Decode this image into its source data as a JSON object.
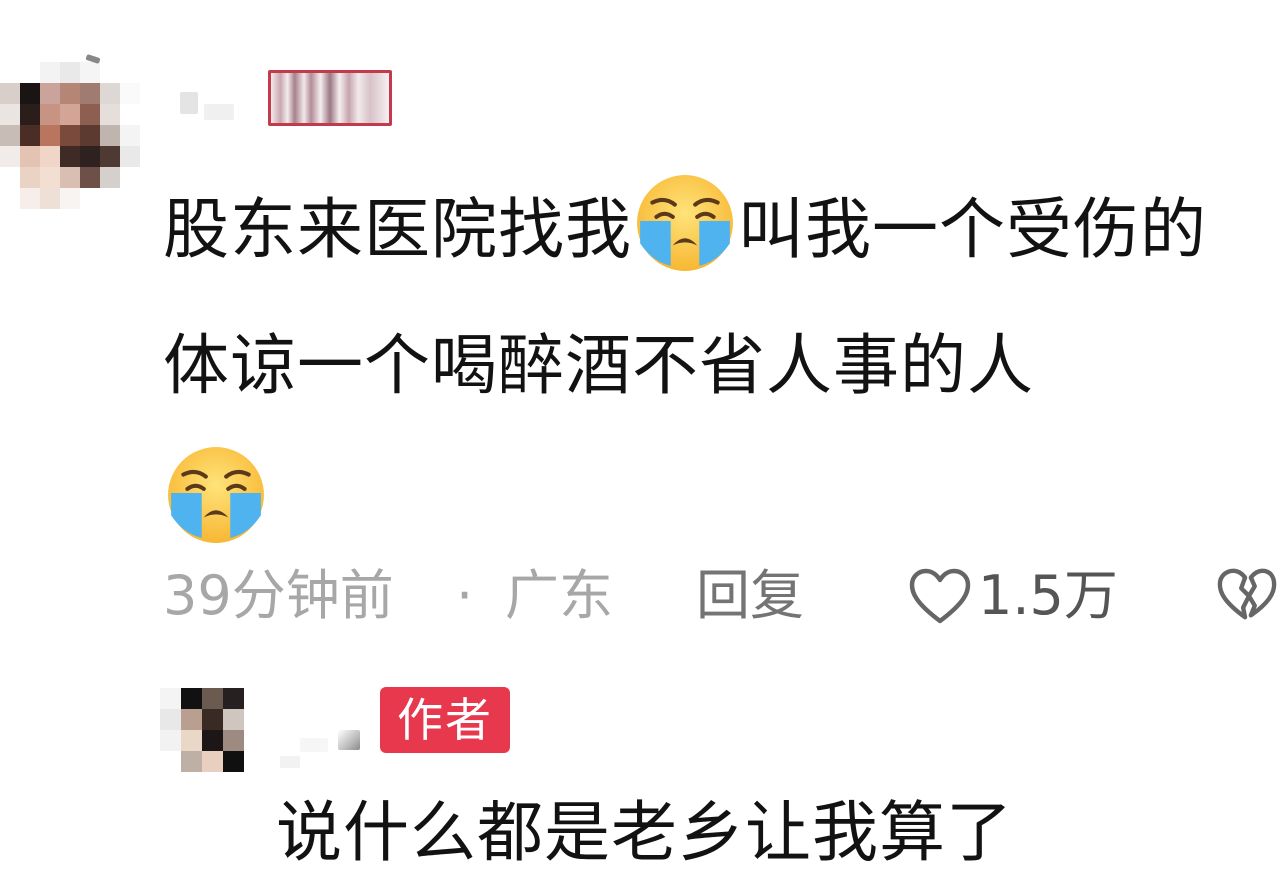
{
  "comment": {
    "text_part1": "股东来医院找我",
    "text_part2": "叫我一个受伤的体谅一个喝醉酒不省人事的人",
    "emoji_1": "loudly-crying-face",
    "emoji_2": "loudly-crying-face"
  },
  "meta": {
    "time": "39分钟前",
    "dot": "·",
    "location": "广东",
    "reply_label": "回复",
    "like_icon": "heart-outline-icon",
    "like_count": "1.5万",
    "dislike_icon": "broken-heart-icon"
  },
  "author_reply": {
    "badge": "作者",
    "text": "说什么都是老乡让我算了"
  },
  "colors": {
    "author_badge": "#e7384e",
    "meta_gray": "#a7a7a7",
    "text": "#121212"
  }
}
